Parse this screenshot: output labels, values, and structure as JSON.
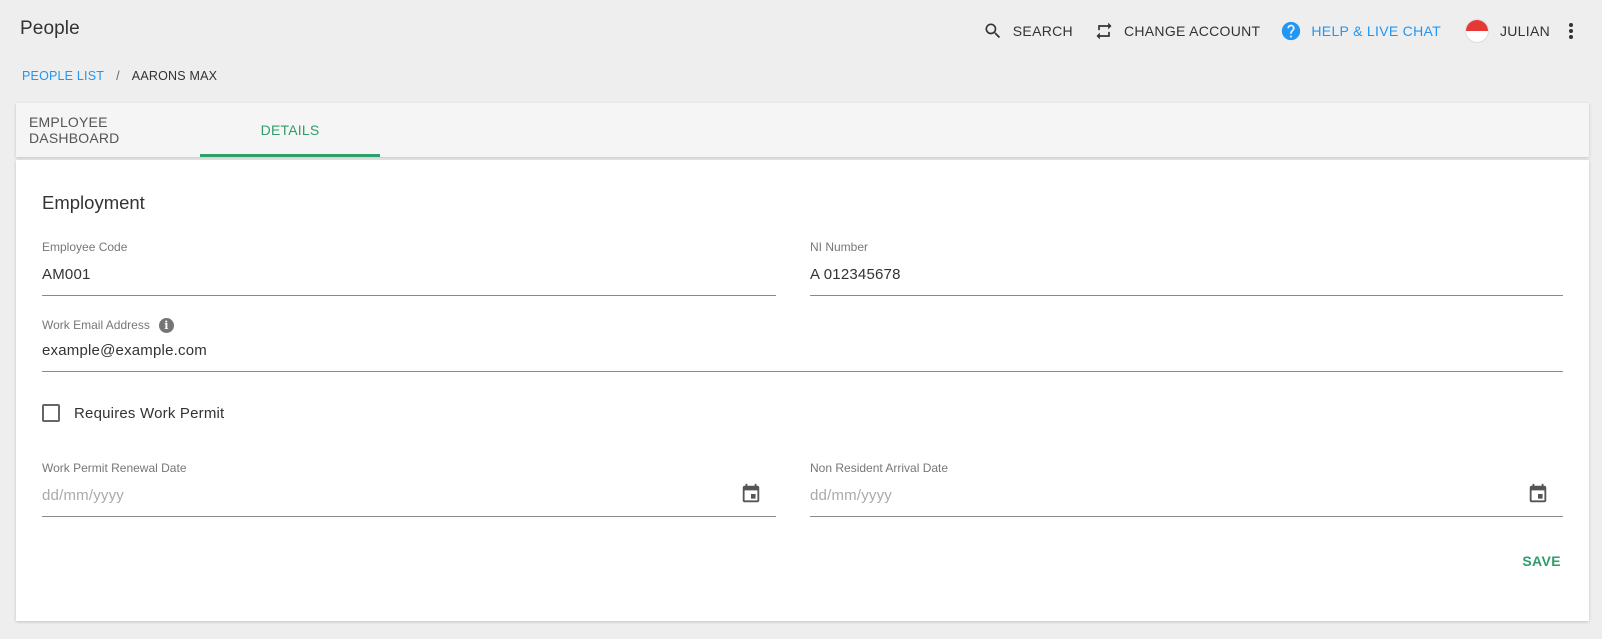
{
  "app": {
    "title": "People"
  },
  "top_actions": {
    "search": {
      "label": "SEARCH",
      "icon": "search-icon"
    },
    "change_account": {
      "label": "CHANGE ACCOUNT",
      "icon": "swap-icon"
    },
    "help": {
      "label": "HELP & LIVE CHAT",
      "icon": "help-circle-icon"
    },
    "user": {
      "label": "JULIAN",
      "icon": "flag-avatar"
    },
    "more": {
      "icon": "more-vertical-icon"
    }
  },
  "breadcrumb": {
    "link": "PEOPLE LIST",
    "separator": "/",
    "current": "AARONS MAX"
  },
  "tabs": [
    {
      "label": "EMPLOYEE DASHBOARD",
      "active": false
    },
    {
      "label": "DETAILS",
      "active": true
    }
  ],
  "form": {
    "section_title": "Employment",
    "employee_code": {
      "label": "Employee Code",
      "value": "AM001"
    },
    "ni_number": {
      "label": "NI Number",
      "value": "A 012345678"
    },
    "work_email": {
      "label": "Work Email Address",
      "value": "example@example.com"
    },
    "work_permit": {
      "label": "Requires Work Permit",
      "checked": false
    },
    "permit_renewal": {
      "label": "Work Permit Renewal Date",
      "placeholder": "dd/mm/yyyy"
    },
    "arrival_date": {
      "label": "Non Resident Arrival Date",
      "placeholder": "dd/mm/yyyy"
    },
    "save_label": "SAVE"
  },
  "colors": {
    "accent_green": "#2e9e6a",
    "link_blue": "#2196f3",
    "background": "#eeeeee"
  }
}
